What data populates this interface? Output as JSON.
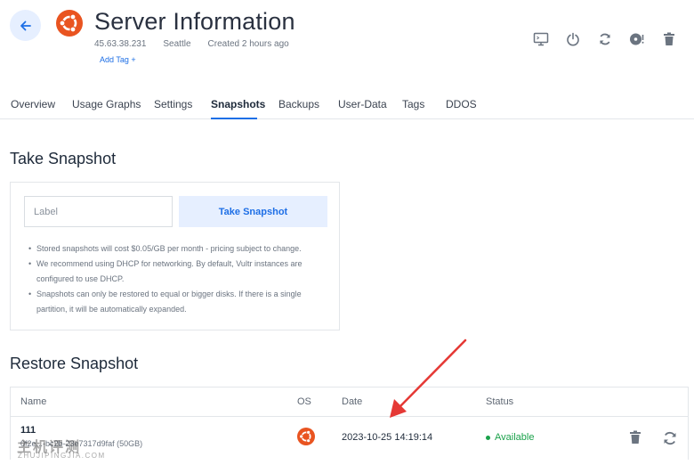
{
  "header": {
    "title": "Server Information",
    "ip": "45.63.38.231",
    "location": "Seattle",
    "created": "Created 2 hours ago",
    "add_tag": "Add Tag +"
  },
  "tabs": [
    {
      "label": "Overview"
    },
    {
      "label": "Usage Graphs"
    },
    {
      "label": "Settings"
    },
    {
      "label": "Snapshots",
      "active": true
    },
    {
      "label": "Backups"
    },
    {
      "label": "User-Data"
    },
    {
      "label": "Tags"
    },
    {
      "label": "DDOS"
    }
  ],
  "take_snapshot": {
    "heading": "Take Snapshot",
    "label_placeholder": "Label",
    "button_label": "Take Snapshot",
    "notes": [
      "Stored snapshots will cost $0.05/GB per month - pricing subject to change.",
      "We recommend using DHCP for networking. By default, Vultr instances are configured to use DHCP.",
      "Snapshots can only be restored to equal or bigger disks. If there is a single partition, it will be automatically expanded."
    ]
  },
  "restore_snapshot": {
    "heading": "Restore Snapshot",
    "columns": [
      "Name",
      "OS",
      "Date",
      "Status"
    ],
    "rows": [
      {
        "name": "111",
        "id_size": "0f2e...-bc2b-23e7317d9faf (50GB)",
        "os_icon": "ubuntu-icon",
        "date": "2023-10-25 14:19:14",
        "status": "Available"
      }
    ]
  },
  "watermark": {
    "text": "主机评测",
    "sub": "ZHUJIPINGJIA.COM"
  },
  "colors": {
    "accent": "#1e6fe6",
    "accent_bg": "#e6efff",
    "ubuntu": "#e95420",
    "status_ok": "#1aa14a",
    "annotation": "#e53935"
  }
}
